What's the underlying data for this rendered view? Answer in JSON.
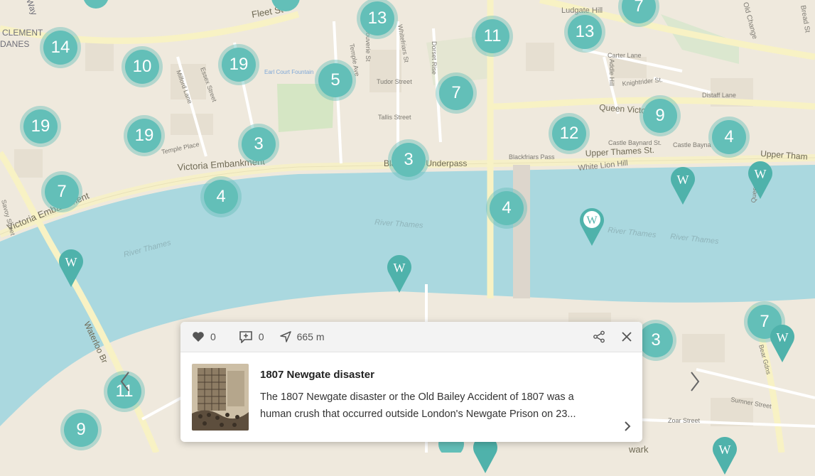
{
  "map": {
    "labels": {
      "clement_danes": "CLEMENT\nDANES",
      "fleet_st": "Fleet St",
      "victoria_embankment_1": "Victoria Embankment",
      "victoria_embankment_2": "Victoria Embankment",
      "blackfriars_underpass": "Blackfriars Underpass",
      "river_thames_1": "River Thames",
      "river_thames_2": "River Thames",
      "river_thames_3": "River Thames",
      "river_thames_4": "River Thames",
      "waterloo_br": "Waterloo Br",
      "queen_victoria": "Queen Victoria",
      "upper_thames_st": "Upper Thames St.",
      "upper_thames_2": "Upper Tham",
      "white_lion_hill": "White Lion Hill",
      "castle_baynard_st": "Castle Baynard St.",
      "castle_baynard_2": "Castle Bayna",
      "carter_lane": "Carter Lane",
      "knightrider_st": "Knightrider St.",
      "distaff_lane": "Distaff Lane",
      "addle_hill": "Addle Hill",
      "tudor_street": "Tudor Street",
      "tallis_street": "Tallis Street",
      "temple_place": "Temple Place",
      "milford_lane": "Milford Lane",
      "essex_street": "Essex Street",
      "dorset_rise": "Dorset Rise",
      "whitefriars_st": "Whitefriars St",
      "bouverie_st": "Bouverie St",
      "temple_ave": "Temple Ave",
      "savoy_street": "Savoy Street",
      "zoar_street": "Zoar Street",
      "sumner_street": "Sumner Street",
      "queenhithe": "Queenhithe",
      "old_change": "Old Change",
      "bread_st": "Bread St",
      "ludgate_hill": "Ludgate Hill",
      "earl_court_fountain": "Earl Court Fountain",
      "blackfriars_pass": "Blackfriars Pass",
      "southwark": "wark",
      "bear_gardens": "Bear Gdns",
      "way": "Way"
    },
    "clusters": [
      "14",
      "10",
      "19",
      "19",
      "19",
      "7",
      "3",
      "4",
      "5",
      "13",
      "3",
      "7",
      "11",
      "13",
      "7",
      "12",
      "9",
      "4",
      "4",
      "3",
      "7",
      "11",
      "9"
    ],
    "wiki_pins_count": 8,
    "colors": {
      "water": "#aad8df",
      "land": "#efe9dd",
      "accent": "#5fbab3"
    }
  },
  "card": {
    "likes": "0",
    "comments": "0",
    "distance": "665 m",
    "title": "1807 Newgate disaster",
    "text_line1": "The 1807 Newgate disaster or the Old Bailey Accident of 1807 was a",
    "text_line2": "human crush that occurred outside London's Newgate Prison on 23..."
  }
}
